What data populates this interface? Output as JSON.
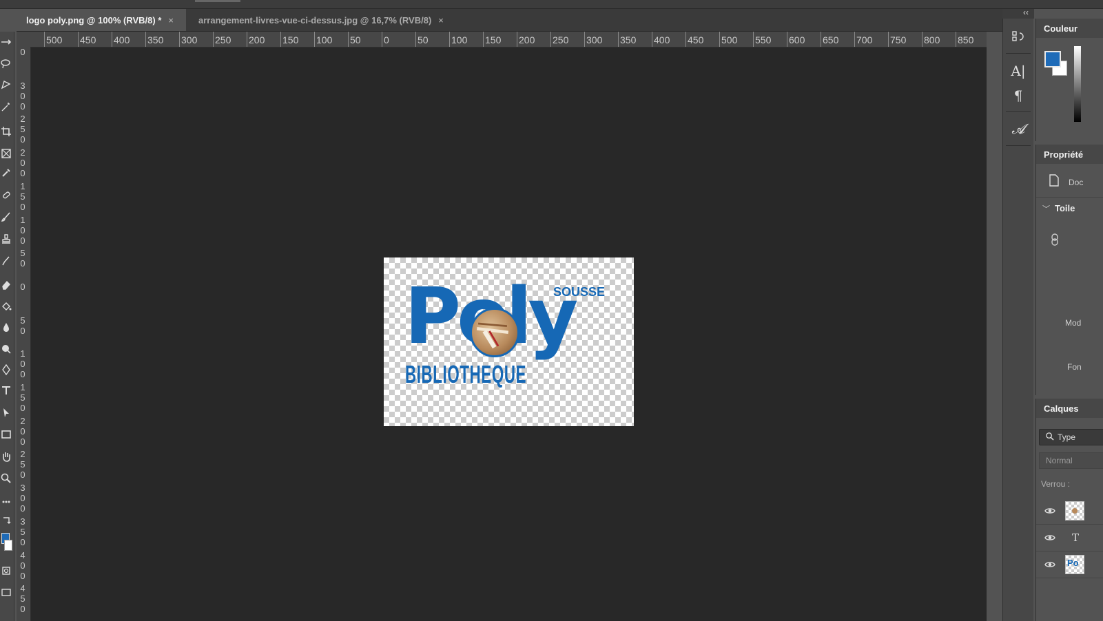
{
  "tabs": [
    {
      "label": "logo poly.png @ 100% (RVB/8) *",
      "active": true
    },
    {
      "label": "arrangement-livres-vue-ci-dessus.jpg @ 16,7% (RVB/8)",
      "active": false
    }
  ],
  "tab_close_glyph": "×",
  "ruler": {
    "horizontal_labels": [
      "500",
      "450",
      "400",
      "350",
      "300",
      "250",
      "200",
      "150",
      "100",
      "50",
      "0",
      "50",
      "100",
      "150",
      "200",
      "250",
      "300",
      "350",
      "400",
      "450",
      "500",
      "550",
      "600",
      "650",
      "700",
      "750",
      "800",
      "850"
    ],
    "vertical_labels": [
      "0",
      "3 0 0",
      "2 5 0",
      "2 0 0",
      "1 5 0",
      "1 0 0",
      "5 0",
      "0",
      "5 0",
      "1 0 0",
      "1 5 0",
      "2 0 0",
      "2 5 0",
      "3 0 0",
      "3 5 0",
      "4 0 0",
      "4 5 0"
    ]
  },
  "document": {
    "logo": {
      "word_main": "Poly",
      "word_top": "SOUSSE",
      "word_bottom": "BIBLIOTHEQUE"
    },
    "logo_color": "#1668b5"
  },
  "panels": {
    "color": {
      "title": "Couleur",
      "foreground": "#1e6bb8",
      "background": "#ffffff"
    },
    "properties": {
      "title": "Propriété",
      "doc_label": "Doc",
      "section": "Toile",
      "mode_label": "Mod",
      "fond_label": "Fon"
    },
    "layers": {
      "title": "Calques",
      "filter_label": "Type",
      "blend_mode": "Normal",
      "lock_label": "Verrou :",
      "layer_text_glyph": "T",
      "layer_thumb_text": "Po"
    }
  },
  "right_icons": [
    "history-icon",
    "character-icon",
    "paragraph-icon",
    "glyphs-icon"
  ],
  "collapse_glyph": "‹‹"
}
